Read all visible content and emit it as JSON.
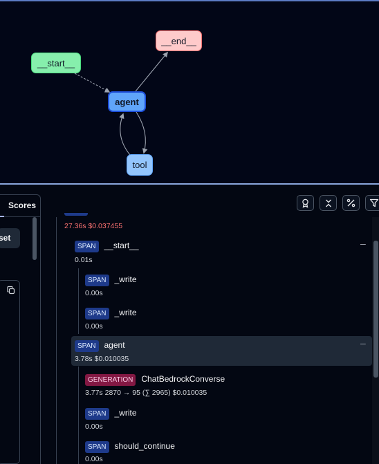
{
  "graph": {
    "nodes": {
      "start": "__start__",
      "end": "__end__",
      "agent": "agent",
      "tool": "tool"
    }
  },
  "panel": {
    "tab_label": "Scores",
    "reset_label": "set"
  },
  "toolbar": {
    "icons": [
      "award-icon",
      "collapse-icon",
      "percent-icon",
      "filter-icon"
    ]
  },
  "trace": {
    "root_meta": "27.36s  $0.037455",
    "items": [
      {
        "badge": "SPAN",
        "name": "__start__",
        "meta": "0.01s"
      },
      {
        "badge": "SPAN",
        "name": "_write",
        "meta": "0.00s"
      },
      {
        "badge": "SPAN",
        "name": "_write",
        "meta": "0.00s"
      },
      {
        "badge": "SPAN",
        "name": "agent",
        "meta": "3.78s  $0.010035"
      },
      {
        "badge": "GENERATION",
        "name": "ChatBedrockConverse",
        "meta": "3.77s  2870 → 95 (∑ 2965)  $0.010035"
      },
      {
        "badge": "SPAN",
        "name": "_write",
        "meta": "0.00s"
      },
      {
        "badge": "SPAN",
        "name": "should_continue",
        "meta": "0.00s"
      }
    ],
    "collapse_symbol": "–"
  },
  "colors": {
    "start_node": "#86efac",
    "end_node": "#fecaca",
    "agent_node": "#60a5fa",
    "tool_node": "#93c5fd",
    "span_badge": "#1e3a8a",
    "generation_badge": "#831843",
    "cost_red": "#f87171"
  }
}
